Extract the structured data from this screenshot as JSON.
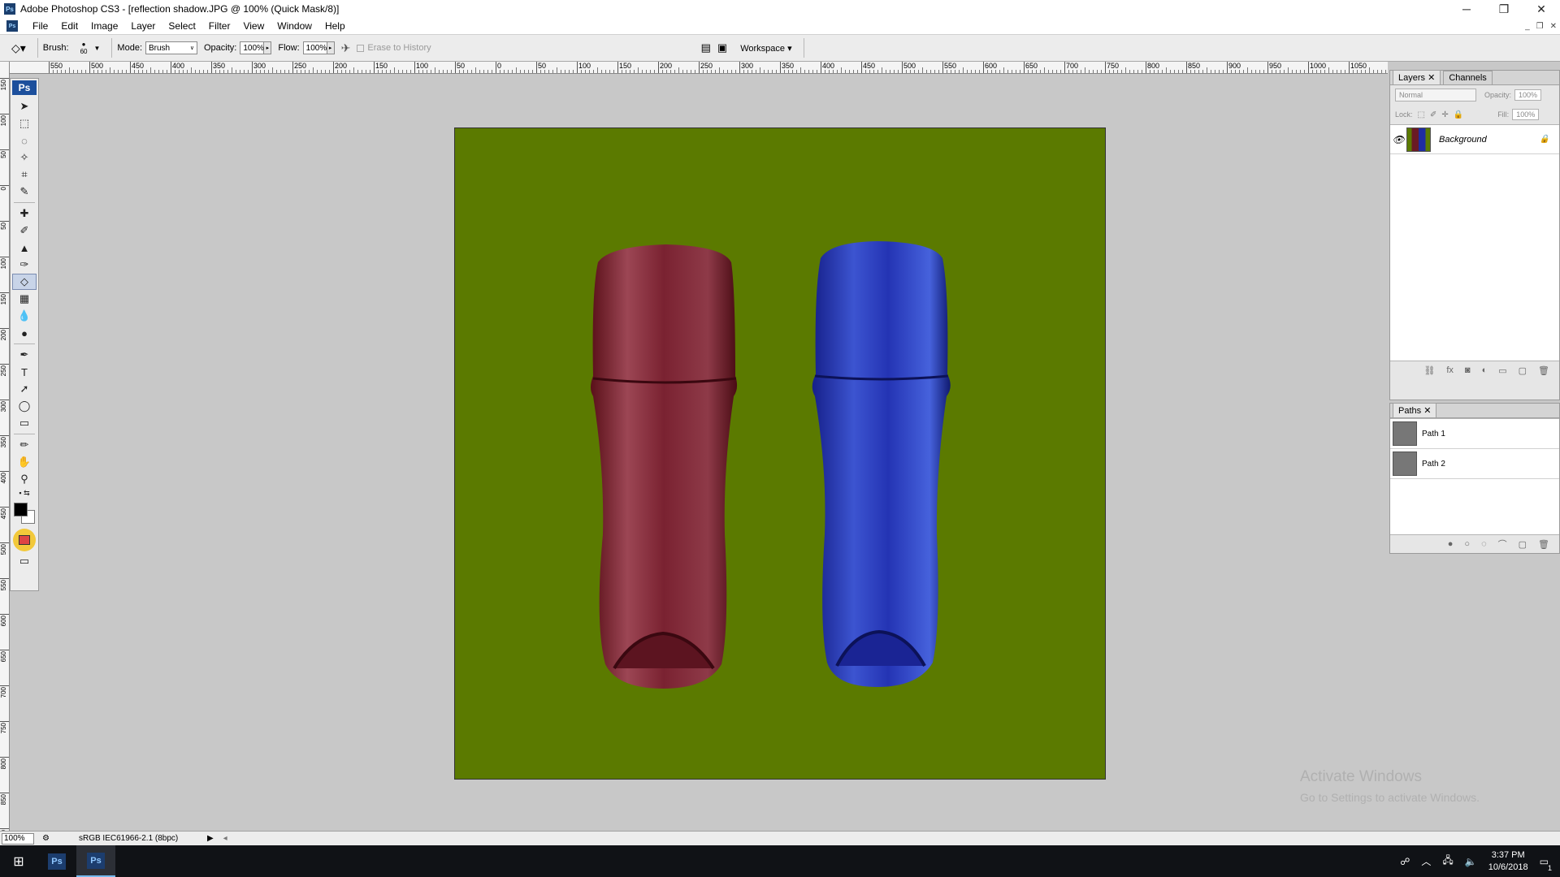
{
  "window": {
    "title": "Adobe Photoshop CS3 - [reflection shadow.JPG @ 100% (Quick Mask/8)]",
    "app_badge": "Ps",
    "minimize": "─",
    "maximize": "❐",
    "close": "✕",
    "doc_minimize": "_",
    "doc_restore": "❐",
    "doc_close": "✕"
  },
  "menu": {
    "items": [
      "File",
      "Edit",
      "Image",
      "Layer",
      "Select",
      "Filter",
      "View",
      "Window",
      "Help"
    ]
  },
  "options": {
    "brush_label": "Brush:",
    "brush_size": "60",
    "mode_label": "Mode:",
    "mode_value": "Brush",
    "opacity_label": "Opacity:",
    "opacity_value": "100%",
    "flow_label": "Flow:",
    "flow_value": "100%",
    "erase_history": "Erase to History",
    "workspace": "Workspace ▾"
  },
  "rulers": {
    "top_labels": [
      "550",
      "500",
      "450",
      "400",
      "350",
      "300",
      "250",
      "200",
      "150",
      "100",
      "50",
      "0",
      "50",
      "100",
      "150",
      "200",
      "250",
      "300",
      "350",
      "400",
      "450",
      "500",
      "550",
      "600",
      "650",
      "700",
      "750",
      "800",
      "850",
      "900",
      "950",
      "1000",
      "1050",
      "1100"
    ],
    "left_labels": [
      "150",
      "100",
      "50",
      "0",
      "50",
      "100",
      "150",
      "200",
      "250",
      "300",
      "350",
      "400",
      "450",
      "500",
      "550",
      "600",
      "650",
      "700",
      "750",
      "800",
      "850",
      "900"
    ]
  },
  "toolbox": {
    "logo": "Ps",
    "tools": [
      {
        "name": "move-tool",
        "glyph": "➤"
      },
      {
        "name": "marquee-tool",
        "glyph": "⬚"
      },
      {
        "name": "lasso-tool",
        "glyph": "◌"
      },
      {
        "name": "magic-wand-tool",
        "glyph": "✧"
      },
      {
        "name": "crop-tool",
        "glyph": "⌗"
      },
      {
        "name": "slice-tool",
        "glyph": "✎"
      },
      {
        "name": "healing-brush-tool",
        "glyph": "✚"
      },
      {
        "name": "brush-tool",
        "glyph": "✐"
      },
      {
        "name": "clone-stamp-tool",
        "glyph": "▲"
      },
      {
        "name": "history-brush-tool",
        "glyph": "✑"
      },
      {
        "name": "eraser-tool",
        "glyph": "◇",
        "active": true
      },
      {
        "name": "gradient-tool",
        "glyph": "▦"
      },
      {
        "name": "blur-tool",
        "glyph": "💧"
      },
      {
        "name": "dodge-tool",
        "glyph": "●"
      },
      {
        "name": "pen-tool",
        "glyph": "✒"
      },
      {
        "name": "type-tool",
        "glyph": "T"
      },
      {
        "name": "path-selection-tool",
        "glyph": "➚"
      },
      {
        "name": "shape-tool",
        "glyph": "◯"
      },
      {
        "name": "notes-tool",
        "glyph": "▭"
      },
      {
        "name": "eyedropper-tool",
        "glyph": "✏"
      },
      {
        "name": "hand-tool",
        "glyph": "✋"
      },
      {
        "name": "zoom-tool",
        "glyph": "⚲"
      }
    ]
  },
  "layers_panel": {
    "tab_layers": "Layers",
    "tab_channels": "Channels",
    "blend_mode": "Normal",
    "opacity_label": "Opacity:",
    "opacity_value": "100%",
    "lock_label": "Lock:",
    "fill_label": "Fill:",
    "fill_value": "100%",
    "layers": [
      {
        "name": "Background",
        "visible": true,
        "locked": true
      }
    ]
  },
  "paths_panel": {
    "tab": "Paths",
    "paths": [
      "Path 1",
      "Path 2"
    ]
  },
  "status": {
    "zoom": "100%",
    "profile": "sRGB IEC61966-2.1 (8bpc)"
  },
  "watermark": {
    "line1": "Activate Windows",
    "line2": "Go to Settings to activate Windows."
  },
  "taskbar": {
    "time": "3:37 PM",
    "date": "10/6/2018",
    "apps": [
      "Ps",
      "Ps"
    ],
    "notification_count": "1"
  },
  "colors": {
    "canvas_bg": "#5b7a00",
    "red_bottle": "#6a1a24",
    "blue_bottle": "#1f2ca0"
  }
}
